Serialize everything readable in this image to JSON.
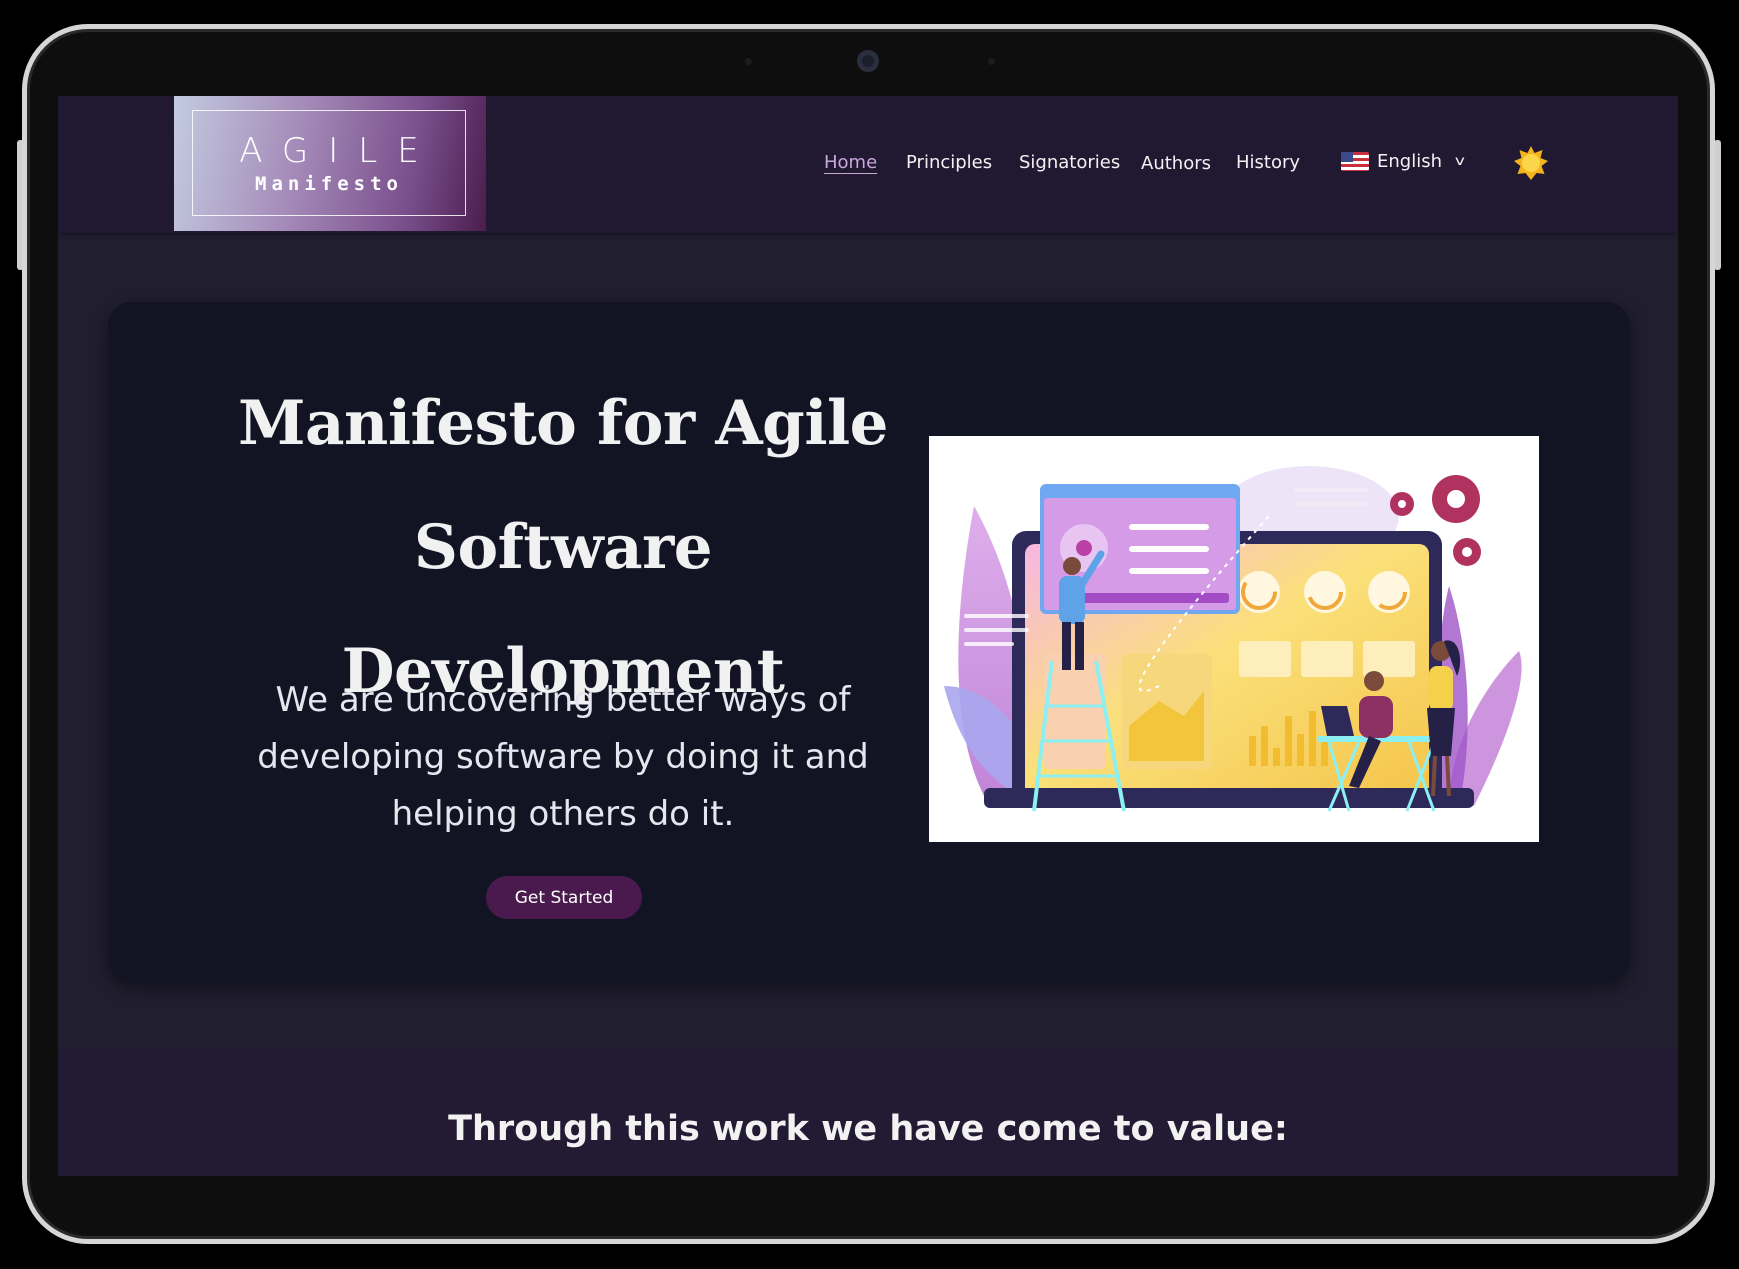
{
  "logo": {
    "line1": "AGILE",
    "line2": "Manifesto"
  },
  "nav": {
    "items": [
      {
        "label": "Home",
        "active": true
      },
      {
        "label": "Principles"
      },
      {
        "label": "Signatories"
      },
      {
        "label": "Authors"
      },
      {
        "label": "History"
      }
    ],
    "language": {
      "label": "English",
      "flag_icon": "us-flag-icon",
      "chevron_icon": "chevron-down-icon"
    },
    "theme_icon": "sun-icon"
  },
  "hero": {
    "title_line1": "Manifesto for Agile",
    "title_line2": "Software Development",
    "text_line1": "We are uncovering better ways of",
    "text_line2": "developing software by doing it and",
    "text_line3": "helping others do it.",
    "cta_label": "Get Started",
    "illustration_icon": "team-dashboard-illustration"
  },
  "values": {
    "heading": "Through this work we have come to value:"
  },
  "colors": {
    "nav_bg": "#211932",
    "page_bg": "#211e30",
    "hero_bg": "#121424",
    "accent": "#4a1a4f",
    "active_link": "#c9a8dc",
    "sun": "#f7c531"
  }
}
